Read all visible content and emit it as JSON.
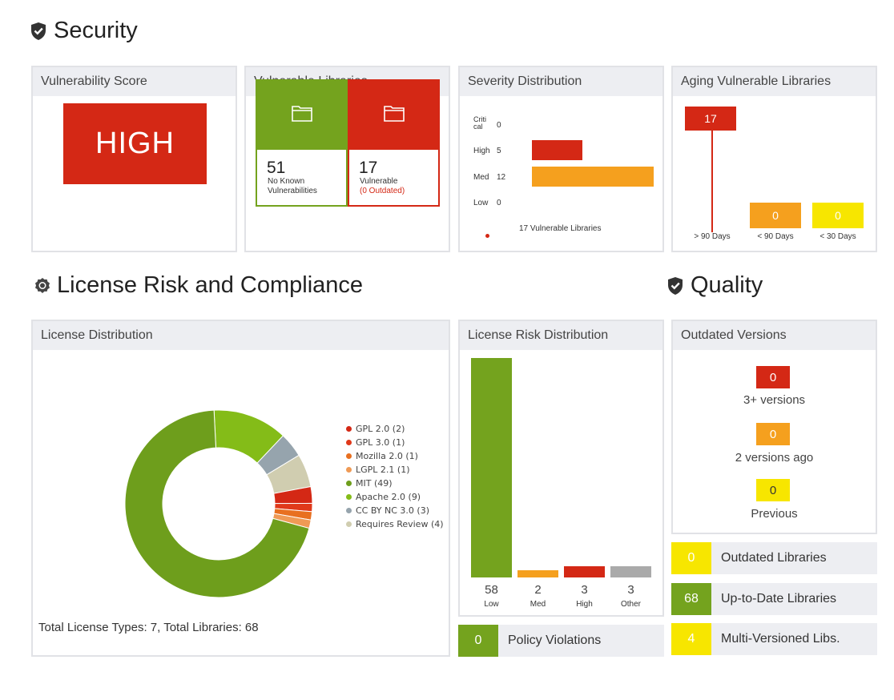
{
  "sections": {
    "security": "Security",
    "license": "License Risk and Compliance",
    "quality": "Quality"
  },
  "vulnerability_score": {
    "title": "Vulnerability Score",
    "value": "HIGH"
  },
  "vulnerable_libraries": {
    "title": "Vulnerable Libraries",
    "safe_count": "51",
    "safe_label_1": "No Known",
    "safe_label_2": "Vulnerabilities",
    "vuln_count": "17",
    "vuln_label": "Vulnerable",
    "vuln_outdated": "(0 Outdated)"
  },
  "severity_distribution": {
    "title": "Severity Distribution",
    "rows": [
      {
        "label": "Criti\ncal",
        "count": "0",
        "value": 0
      },
      {
        "label": "High",
        "count": "5",
        "value": 5
      },
      {
        "label": "Med",
        "count": "12",
        "value": 12
      },
      {
        "label": "Low",
        "count": "0",
        "value": 0
      }
    ],
    "max": 12,
    "footer": "17 Vulnerable Libraries"
  },
  "aging": {
    "title": "Aging Vulnerable Libraries",
    "bars": [
      {
        "label": "> 90 Days",
        "value": "17",
        "color": "#d42815"
      },
      {
        "label": "< 90 Days",
        "value": "0",
        "color": "#f5a01e"
      },
      {
        "label": "< 30 Days",
        "value": "0",
        "color": "#f7e600"
      }
    ]
  },
  "license_distribution": {
    "title": "License Distribution",
    "legend": [
      {
        "label": "GPL 2.0 (2)",
        "value": 2,
        "color": "#d42815"
      },
      {
        "label": "GPL 3.0 (1)",
        "value": 1,
        "color": "#e0391a"
      },
      {
        "label": "Mozilla 2.0 (1)",
        "value": 1,
        "color": "#e87020"
      },
      {
        "label": "LGPL 2.1 (1)",
        "value": 1,
        "color": "#ef9a55"
      },
      {
        "label": "MIT (49)",
        "value": 49,
        "color": "#6e9e1c"
      },
      {
        "label": "Apache 2.0 (9)",
        "value": 9,
        "color": "#84bc18"
      },
      {
        "label": "CC BY NC 3.0 (3)",
        "value": 3,
        "color": "#96a4ad"
      },
      {
        "label": "Requires Review (4)",
        "value": 4,
        "color": "#d0cdb0"
      }
    ],
    "footer": "Total License Types: 7, Total Libraries: 68"
  },
  "license_risk": {
    "title": "License Risk Distribution",
    "bars": [
      {
        "label": "Low",
        "value": 58,
        "text": "58",
        "color": "#74a31e"
      },
      {
        "label": "Med",
        "value": 2,
        "text": "2",
        "color": "#f5a01e"
      },
      {
        "label": "High",
        "value": 3,
        "text": "3",
        "color": "#d42815"
      },
      {
        "label": "Other",
        "value": 3,
        "text": "3",
        "color": "#aaaaaa"
      }
    ],
    "policy_count": "0",
    "policy_label": "Policy Violations"
  },
  "outdated_versions": {
    "title": "Outdated Versions",
    "items": [
      {
        "value": "0",
        "label": "3+ versions",
        "color": "#d42815"
      },
      {
        "value": "0",
        "label": "2 versions ago",
        "color": "#f5a01e"
      },
      {
        "value": "0",
        "label": "Previous",
        "color": "#f7e600"
      }
    ]
  },
  "quality_stats": [
    {
      "value": "0",
      "label": "Outdated Libraries",
      "color": "#f7e600"
    },
    {
      "value": "68",
      "label": "Up-to-Date Libraries",
      "color": "#74a31e"
    },
    {
      "value": "4",
      "label": "Multi-Versioned Libs.",
      "color": "#f7e600"
    }
  ]
}
